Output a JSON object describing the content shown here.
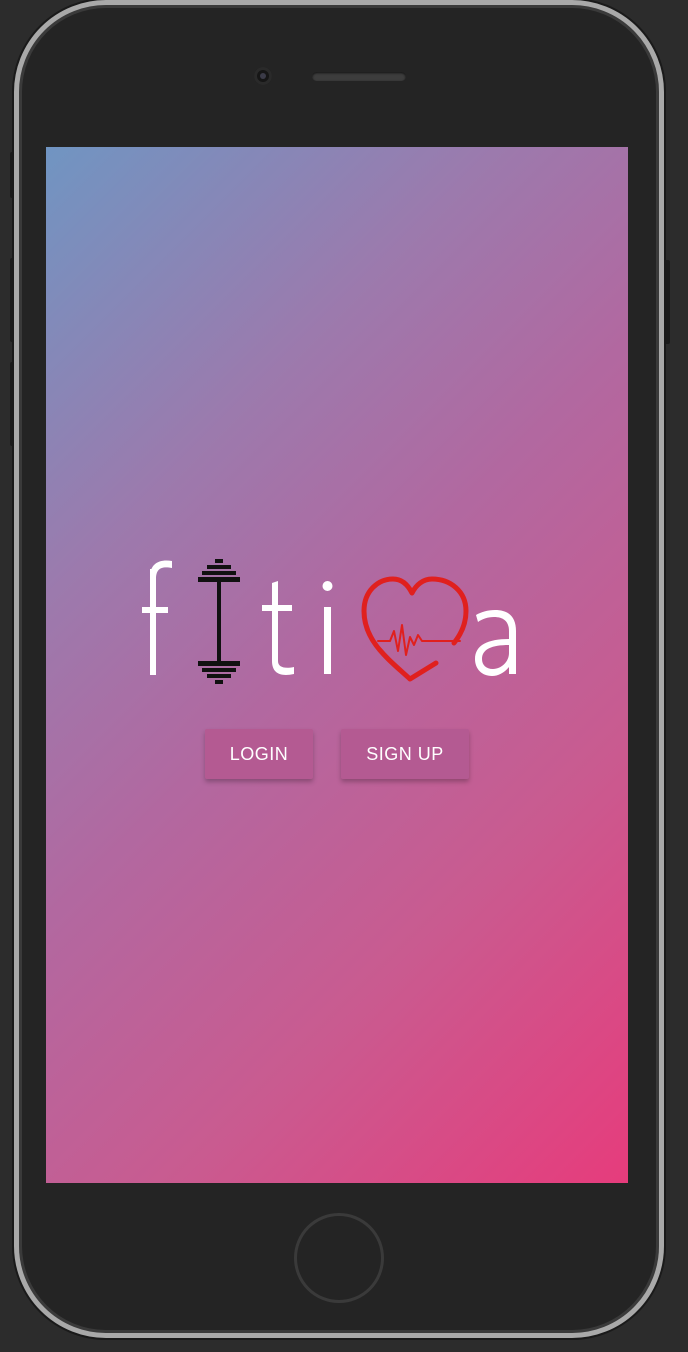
{
  "device": {
    "frame_color": "#a9a9a9",
    "body_color": "#242424"
  },
  "screen": {
    "gradient_colors": [
      "#7095c2",
      "#b268a0",
      "#e63c7c"
    ]
  },
  "logo": {
    "text": "fitiva",
    "icons": [
      "dumbbell-icon",
      "heartbeat-heart-icon"
    ],
    "text_color": "#ffffff",
    "heart_color": "#e0201e"
  },
  "actions": {
    "login_label": "LOGIN",
    "signup_label": "SIGN UP"
  }
}
